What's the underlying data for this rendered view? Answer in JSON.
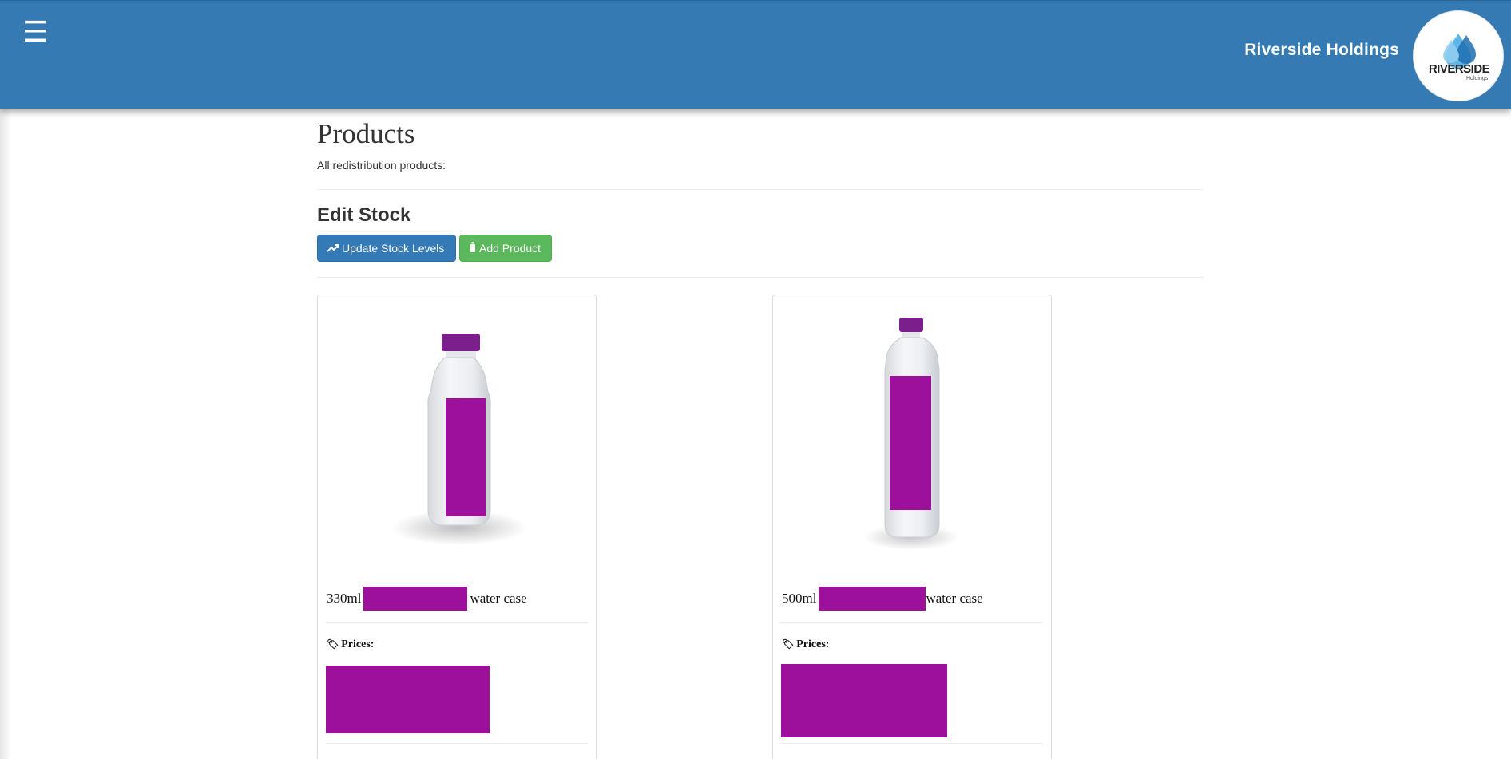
{
  "header": {
    "menu_icon": "hamburger-menu-icon",
    "brand_name": "Riverside Holdings",
    "logo": {
      "text": "RIVERSIDE",
      "subtext": "Holdings",
      "icon": "water-drops-logo-icon"
    },
    "colors": {
      "bar": "#357ab2",
      "logo_drop_light": "#5fb6e6",
      "logo_drop_dark": "#1f6fb0"
    }
  },
  "page": {
    "title": "Products",
    "subtitle": "All redistribution products:",
    "edit_section_title": "Edit Stock"
  },
  "toolbar": {
    "update_stock": {
      "label": "Update Stock Levels",
      "icon": "trending-up-icon",
      "color": "#337ab7"
    },
    "add_product": {
      "label": "Add Product",
      "icon": "bottle-icon",
      "color": "#5cb85c"
    }
  },
  "products": [
    {
      "size": "330ml",
      "suffix": "water case",
      "prices_label": "Prices:",
      "prices_icon": "tags-icon",
      "image": "bottle-image",
      "redaction_color": "#9c109c"
    },
    {
      "size": "500ml",
      "suffix": "water case",
      "prices_label": "Prices:",
      "prices_icon": "tags-icon",
      "image": "bottle-image",
      "redaction_color": "#9c109c"
    }
  ]
}
